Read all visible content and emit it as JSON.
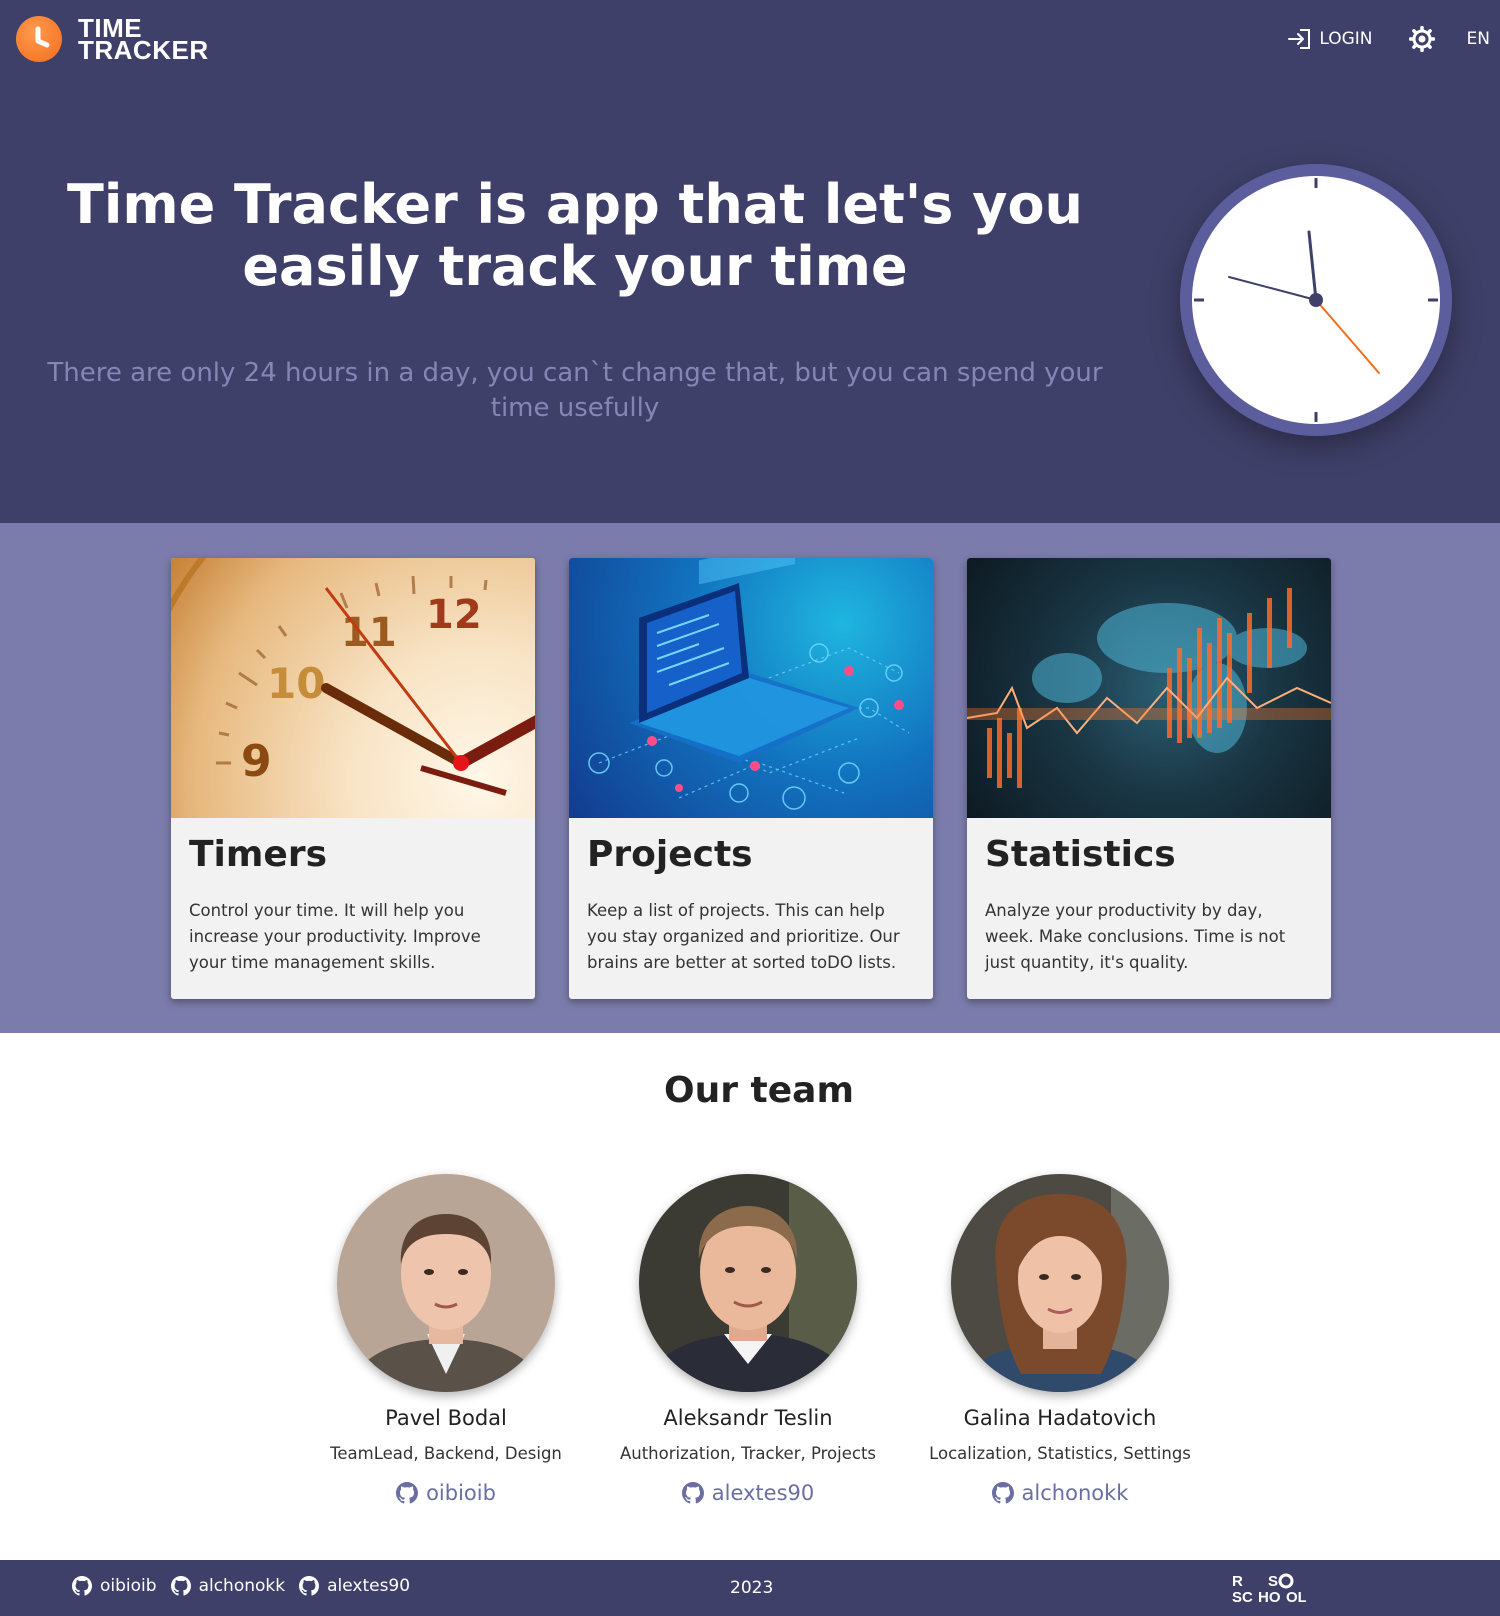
{
  "header": {
    "logo_line1": "TIME",
    "logo_line2": "TRACKER",
    "login_label": "LOGIN",
    "theme_icon": "gear-icon",
    "language": "EN"
  },
  "hero": {
    "title": "Time Tracker is app that let's you easily track your time",
    "subtitle": "There are only 24 hours in a day, you can`t change that, but you can spend your time usefully"
  },
  "features": [
    {
      "title": "Timers",
      "text": "Control your time. It will help you increase your productivity. Improve your time management skills."
    },
    {
      "title": "Projects",
      "text": "Keep a list of projects. This can help you stay organized and prioritize. Our brains are better at sorted toDO lists."
    },
    {
      "title": "Statistics",
      "text": "Analyze your productivity by day, week. Make conclusions. Time is not just quantity, it's quality."
    }
  ],
  "team": {
    "title": "Our team",
    "members": [
      {
        "name": "Pavel Bodal",
        "role": "TeamLead, Backend, Design",
        "github": "oibioib"
      },
      {
        "name": "Aleksandr Teslin",
        "role": "Authorization, Tracker, Projects",
        "github": "alextes90"
      },
      {
        "name": "Galina Hadatovich",
        "role": "Localization, Statistics, Settings",
        "github": "alchonokk"
      }
    ]
  },
  "footer": {
    "links": [
      "oibioib",
      "alchonokk",
      "alextes90"
    ],
    "year": "2023",
    "school_logo": "RS SCHOOL"
  },
  "colors": {
    "header_bg": "#3f4069",
    "features_bg": "#7b7cab",
    "accent_orange": "#f36d1c",
    "link_color": "#6b6ea3"
  }
}
